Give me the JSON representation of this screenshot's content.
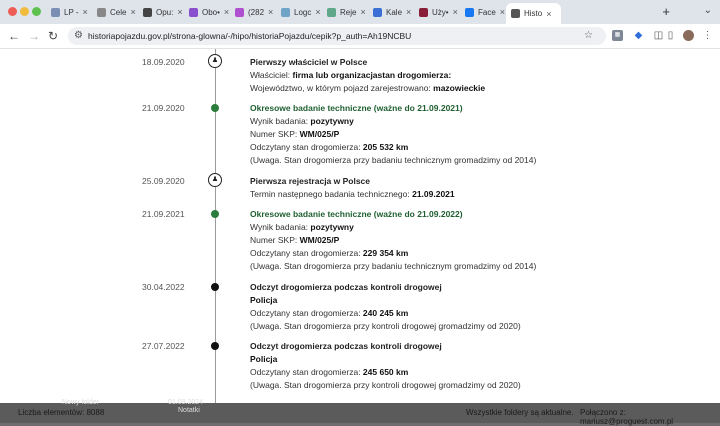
{
  "tabs": [
    {
      "label": "LP -",
      "fav_color": "#7a8fb3"
    },
    {
      "label": "Cele",
      "fav_color": "#888888"
    },
    {
      "label": "Opu:",
      "fav_color": "#444444"
    },
    {
      "label": "Obo•",
      "fav_color": "#8a4fcf"
    },
    {
      "label": "(282",
      "fav_color": "#b04fcf"
    },
    {
      "label": "Logc",
      "fav_color": "#6fa3c7"
    },
    {
      "label": "Reje",
      "fav_color": "#5fa88a"
    },
    {
      "label": "Kale",
      "fav_color": "#3b6fd6"
    },
    {
      "label": "Uży•",
      "fav_color": "#8a1f3a"
    },
    {
      "label": "Face",
      "fav_color": "#1877f2"
    },
    {
      "label": "Histo",
      "fav_color": "#555555",
      "active": true
    }
  ],
  "toolbar": {
    "url": "historiapojazdu.gov.pl/strona-glowna/-/hipo/historiaPojazdu/cepik?p_auth=Ah19NCBU"
  },
  "timeline": [
    {
      "date": "18.09.2020",
      "marker": "ring",
      "title": "Pierwszy właściciel w Polsce",
      "title_style": "plain",
      "lines": [
        {
          "label": "Właściciel: ",
          "value": "firma lub organizacjastan drogomierza:"
        },
        {
          "label": "Województwo, w którym pojazd zarejestrowano: ",
          "value": "mazowieckie"
        }
      ]
    },
    {
      "date": "21.09.2020",
      "marker": "green",
      "title": "Okresowe badanie techniczne (ważne do 21.09.2021)",
      "title_style": "green",
      "lines": [
        {
          "label": "Wynik badania: ",
          "value": "pozytywny"
        },
        {
          "label": "Numer SKP: ",
          "value": "WM/025/P"
        },
        {
          "label": "Odczytany stan drogomierza: ",
          "value": "205 532 km"
        },
        {
          "label": "(Uwaga. Stan drogomierza przy badaniu technicznym gromadzimy od 2014)",
          "value": ""
        }
      ]
    },
    {
      "date": "25.09.2020",
      "marker": "ring",
      "title": "Pierwsza rejestracja w Polsce",
      "title_style": "plain",
      "lines": [
        {
          "label": "Termin następnego badania technicznego: ",
          "value": "21.09.2021"
        }
      ]
    },
    {
      "date": "21.09.2021",
      "marker": "green",
      "title": "Okresowe badanie techniczne (ważne do 21.09.2022)",
      "title_style": "green",
      "lines": [
        {
          "label": "Wynik badania: ",
          "value": "pozytywny"
        },
        {
          "label": "Numer SKP: ",
          "value": "WM/025/P"
        },
        {
          "label": "Odczytany stan drogomierza: ",
          "value": "229 354 km"
        },
        {
          "label": "(Uwaga. Stan drogomierza przy badaniu technicznym gromadzimy od 2014)",
          "value": ""
        }
      ]
    },
    {
      "date": "30.04.2022",
      "marker": "black",
      "title": "Odczyt drogomierza podczas kontroli drogowej",
      "title_style": "plain",
      "lines": [
        {
          "label": "",
          "value": "Policja"
        },
        {
          "label": "Odczytany stan drogomierza: ",
          "value": "240 245 km"
        },
        {
          "label": "(Uwaga. Stan drogomierza przy kontroli drogowej gromadzimy od 2020)",
          "value": ""
        }
      ]
    },
    {
      "date": "27.07.2022",
      "marker": "black",
      "title": "Odczyt drogomierza podczas kontroli drogowej",
      "title_style": "plain",
      "lines": [
        {
          "label": "",
          "value": "Policja"
        },
        {
          "label": "Odczytany stan drogomierza: ",
          "value": "245 650 km"
        },
        {
          "label": "(Uwaga. Stan drogomierza przy kontroli drogowej gromadzimy od 2020)",
          "value": ""
        }
      ]
    }
  ],
  "bottom_bar": {
    "left": "Liczba elementów: 8088",
    "middle": "Wszystkie foldery są aktualne.",
    "right": "Połączono z: mariusz@proguest.com.pl",
    "peek_left": "Nowy folder",
    "peek_mid": "01.09.2024",
    "peek_mid2": "Notatki"
  }
}
